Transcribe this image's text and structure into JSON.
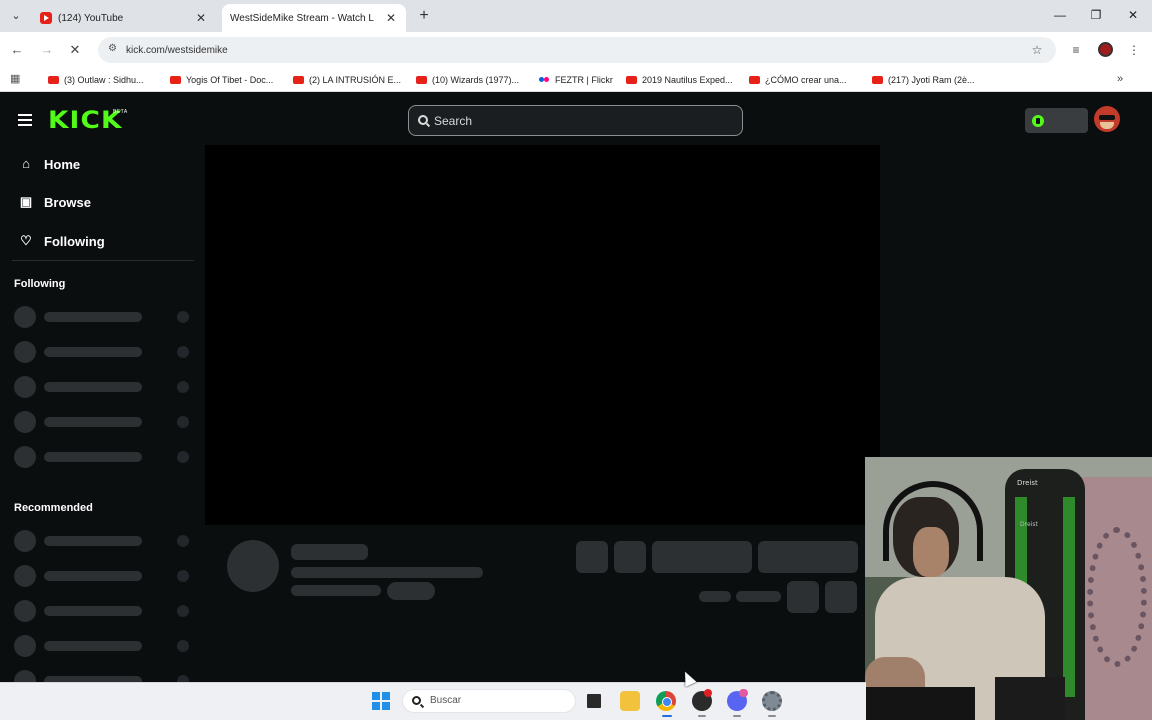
{
  "browser": {
    "tabs": [
      {
        "label": "(124) YouTube",
        "icon": "youtube-icon"
      },
      {
        "label": "WestSideMike Stream - Watch L",
        "icon": "kick-icon"
      }
    ],
    "url": "kick.com/westsidemike",
    "bookmarks": [
      {
        "label": "(3) Outlaw : Sidhu..."
      },
      {
        "label": "Yogis Of Tibet - Doc..."
      },
      {
        "label": "(2) LA INTRUSIÓN E..."
      },
      {
        "label": "(10) Wizards (1977)..."
      },
      {
        "label": "FEZTR | Flickr"
      },
      {
        "label": "2019 Nautilus Exped..."
      },
      {
        "label": "¿CÓMO crear una..."
      },
      {
        "label": "(217) Jyoti Ram (2è..."
      }
    ]
  },
  "kick": {
    "logo": "KICK",
    "beta": "BETA",
    "search_placeholder": "Search",
    "brand_color": "#53fc18",
    "nav": [
      {
        "label": "Home",
        "icon": "home-icon"
      },
      {
        "label": "Browse",
        "icon": "browse-icon"
      },
      {
        "label": "Following",
        "icon": "heart-icon"
      }
    ],
    "sections": {
      "following": "Following",
      "recommended": "Recommended"
    }
  },
  "webcam": {
    "chair_brand": "Dreist",
    "chair_brand_small": "Dreist"
  },
  "taskbar": {
    "search_placeholder": "Buscar",
    "apps": [
      "windows-start-icon",
      "task-view-icon",
      "file-explorer-icon",
      "chrome-icon",
      "obs-icon",
      "discord-icon",
      "settings-icon"
    ]
  }
}
